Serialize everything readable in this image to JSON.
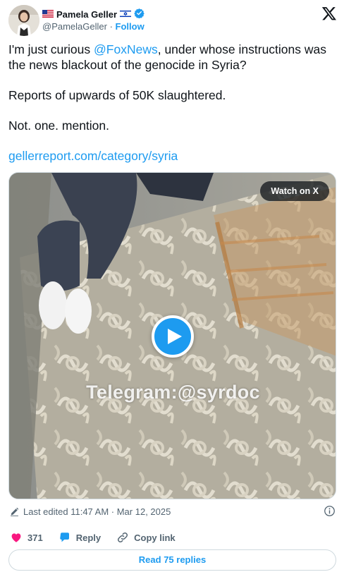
{
  "author": {
    "name": "Pamela Geller",
    "handle": "@PamelaGeller",
    "separator": "·",
    "follow_label": "Follow",
    "flag_left_icon": "us-flag-icon",
    "flag_right_icon": "israel-flag-icon",
    "verified_icon": "verified-badge-icon",
    "avatar_icon": "profile-photo"
  },
  "platform_icon": "x-logo-icon",
  "tweet": {
    "line1_prefix": "I'm just curious ",
    "mention": "@FoxNews",
    "line1_suffix": ", under whose instructions was the news blackout of the genocide in Syria?",
    "para2": "Reports of upwards of 50K slaughtered.",
    "para3": "Not. one. mention.",
    "link": "gellerreport.com/category/syria"
  },
  "media": {
    "watch_label": "Watch on X",
    "watermark": "Telegram:@syrdoc",
    "play_icon": "play-icon"
  },
  "meta": {
    "edited": "Last edited 11:47 AM · Mar 12, 2025",
    "edit_icon": "pencil-icon",
    "info_icon": "info-icon"
  },
  "actions": {
    "like_count": "371",
    "reply_label": "Reply",
    "copy_label": "Copy link",
    "like_icon": "heart-icon",
    "reply_icon": "speech-bubble-icon",
    "copy_icon": "link-icon"
  },
  "read_replies": "Read 75 replies",
  "colors": {
    "accent": "#1d9bf0",
    "secondary_text": "#536471",
    "like": "#f91880",
    "border": "#cfd9de"
  }
}
